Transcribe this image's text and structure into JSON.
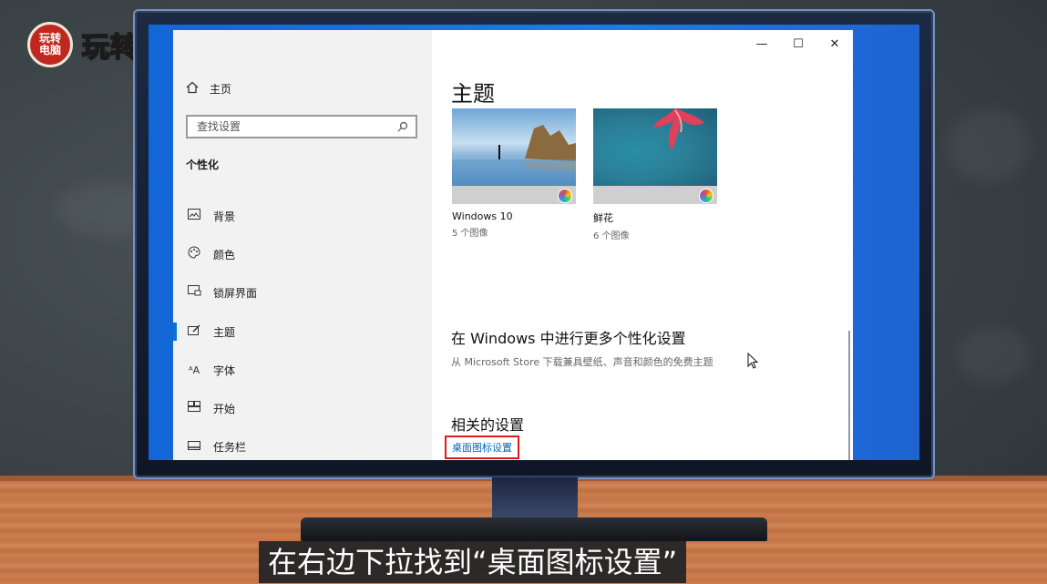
{
  "logo": {
    "badge_text": "玩转电脑",
    "text": "玩转电脑"
  },
  "window": {
    "controls": {
      "minimize": "—",
      "maximize": "☐",
      "close": "✕"
    },
    "sidebar": {
      "home_label": "主页",
      "search_placeholder": "查找设置",
      "section_title": "个性化",
      "items": [
        {
          "label": "背景",
          "icon": "picture-icon"
        },
        {
          "label": "颜色",
          "icon": "palette-icon"
        },
        {
          "label": "锁屏界面",
          "icon": "lock-screen-icon"
        },
        {
          "label": "主题",
          "icon": "theme-brush-icon",
          "active": true
        },
        {
          "label": "字体",
          "icon": "font-icon"
        },
        {
          "label": "开始",
          "icon": "start-icon"
        },
        {
          "label": "任务栏",
          "icon": "taskbar-icon"
        }
      ]
    },
    "main": {
      "title": "主题",
      "themes": [
        {
          "name": "Windows 10",
          "count": "5 个图像"
        },
        {
          "name": "鲜花",
          "count": "6 个图像"
        }
      ],
      "more_heading": "在 Windows 中进行更多个性化设置",
      "more_desc": "从 Microsoft Store 下载兼具壁纸、声音和颜色的免费主题",
      "related_heading": "相关的设置",
      "desktop_icon_link": "桌面图标设置"
    }
  },
  "subtitle": "在右边下拉找到“桌面图标设置”",
  "colors": {
    "accent": "#0078d7",
    "highlight_box": "#e01b1b",
    "logo_red": "#c0271f"
  }
}
